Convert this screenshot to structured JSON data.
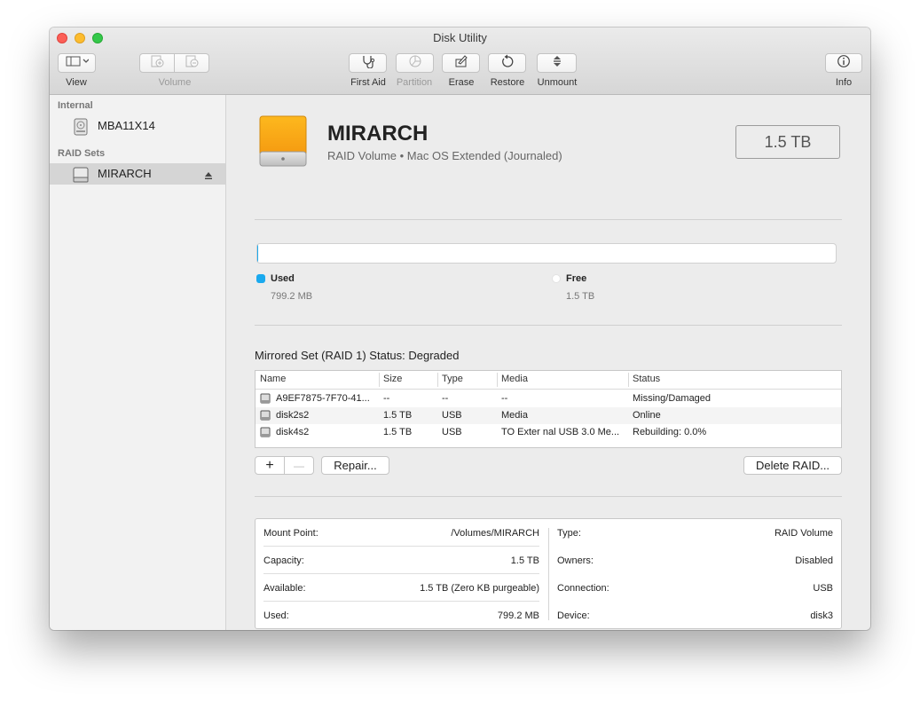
{
  "window": {
    "title": "Disk Utility"
  },
  "colors": {
    "used": "#1aa9ee",
    "free": "#ffffff",
    "accent": "#f8a91b"
  },
  "toolbar": {
    "view_label": "View",
    "volume_label": "Volume",
    "first_aid_label": "First Aid",
    "partition_label": "Partition",
    "erase_label": "Erase",
    "restore_label": "Restore",
    "unmount_label": "Unmount",
    "info_label": "Info"
  },
  "sidebar": {
    "internal_header": "Internal",
    "internal_items": [
      {
        "label": "MBA11X14",
        "icon": "internal-disk-icon"
      }
    ],
    "raid_header": "RAID Sets",
    "raid_items": [
      {
        "label": "MIRARCH",
        "icon": "raid-disk-icon",
        "selected": true
      }
    ]
  },
  "volume": {
    "name": "MIRARCH",
    "subtitle": "RAID Volume • Mac OS Extended (Journaled)",
    "size_badge": "1.5 TB",
    "used_label": "Used",
    "used_value": "799.2 MB",
    "free_label": "Free",
    "free_value": "1.5 TB",
    "used_fraction": 0.0005
  },
  "raid": {
    "status": "Mirrored Set (RAID 1) Status: Degraded",
    "columns": [
      "Name",
      "Size",
      "Type",
      "Media",
      "Status"
    ],
    "rows": [
      {
        "name": "A9EF7875-7F70-41...",
        "size": "--",
        "type": "--",
        "media": "--",
        "status": "Missing/Damaged"
      },
      {
        "name": "disk2s2",
        "size": "1.5 TB",
        "type": "USB",
        "media": "Media",
        "status": "Online"
      },
      {
        "name": "disk4s2",
        "size": "1.5 TB",
        "type": "USB",
        "media": "TO Exter nal USB 3.0 Me...",
        "status": "Rebuilding: 0.0%"
      }
    ],
    "add_label": "+",
    "remove_label": "—",
    "repair_label": "Repair...",
    "delete_label": "Delete RAID..."
  },
  "info": {
    "left": [
      {
        "key": "Mount Point:",
        "value": "/Volumes/MIRARCH"
      },
      {
        "key": "Capacity:",
        "value": "1.5 TB"
      },
      {
        "key": "Available:",
        "value": "1.5 TB (Zero KB purgeable)"
      },
      {
        "key": "Used:",
        "value": "799.2 MB"
      }
    ],
    "right": [
      {
        "key": "Type:",
        "value": "RAID Volume"
      },
      {
        "key": "Owners:",
        "value": "Disabled"
      },
      {
        "key": "Connection:",
        "value": "USB"
      },
      {
        "key": "Device:",
        "value": "disk3"
      }
    ]
  }
}
